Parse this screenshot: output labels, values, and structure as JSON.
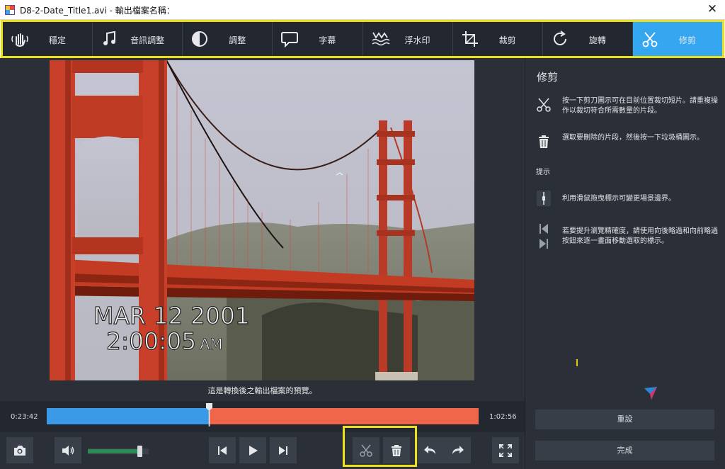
{
  "window": {
    "title": "D8-2-Date_Title1.avi - 輸出檔案名稱："
  },
  "toolbar": {
    "tabs": [
      {
        "label": "穩定",
        "icon": "stabilize-hand-icon",
        "active": false
      },
      {
        "label": "音訊調整",
        "icon": "music-note-icon",
        "active": false
      },
      {
        "label": "調整",
        "icon": "contrast-icon",
        "active": false
      },
      {
        "label": "字幕",
        "icon": "speech-bubble-icon",
        "active": false
      },
      {
        "label": "浮水印",
        "icon": "watermark-icon",
        "active": false
      },
      {
        "label": "裁剪",
        "icon": "crop-icon",
        "active": false
      },
      {
        "label": "旋轉",
        "icon": "rotate-icon",
        "active": false
      },
      {
        "label": "修剪",
        "icon": "scissors-icon",
        "active": true
      }
    ]
  },
  "preview": {
    "caption": "這是轉換後之輸出檔案的預覽。",
    "overlay_date": "MAR 12 2001",
    "overlay_time": "2:00:05",
    "overlay_ampm": "AM"
  },
  "timeline": {
    "start_time": "0:23:42",
    "end_time": "1:02:56",
    "kept_color": "#3b9ae8",
    "removed_color": "#f0664b"
  },
  "controls": {
    "volume_level": 0.85,
    "buttons": [
      "snapshot-camera-icon",
      "volume-icon",
      "previous-frame-icon",
      "play-icon",
      "next-frame-icon",
      "scissors-icon",
      "trash-icon",
      "undo-icon",
      "redo-icon",
      "fullscreen-icon"
    ]
  },
  "sidebar": {
    "title": "修剪",
    "cut_help": "按一下剪刀圖示可在目前位置裁切短片。請重複操作以裁切符合所需數量的片段。",
    "delete_help": "選取要刪除的片段，然後按一下垃圾桶圖示。",
    "hints_label": "提示",
    "marker_hint": "利用滑鼠拖曳標示可變更場景邊界。",
    "skip_hint": "若要提升瀏覽精確度，請使用向後略過和向前略過按鈕來逐一畫面移動選取的標示。",
    "reset_button": "重設",
    "done_button": "完成"
  },
  "colors": {
    "accent": "#35a6f0",
    "highlight": "#ece01c",
    "panel": "#2b3038",
    "toolbar_bg": "#232830"
  }
}
